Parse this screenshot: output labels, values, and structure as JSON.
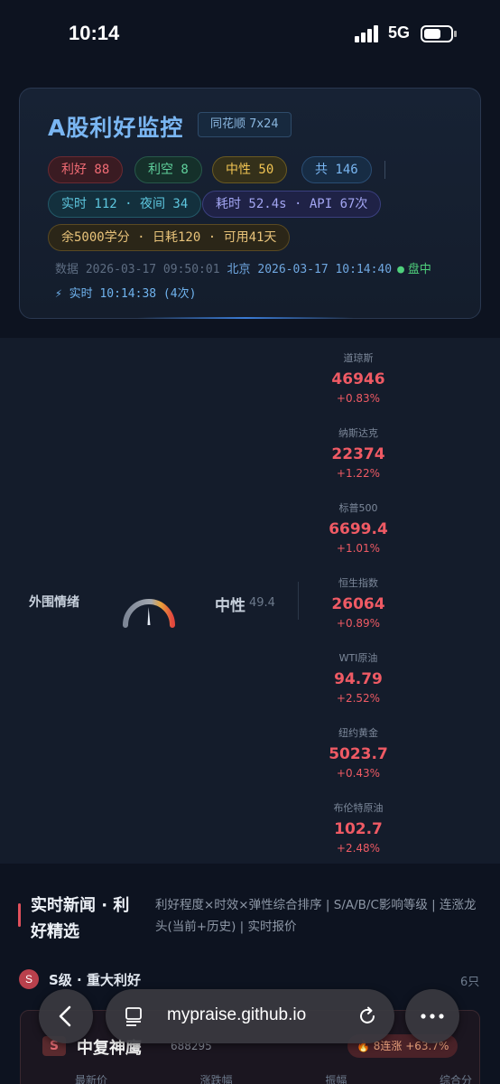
{
  "status_bar": {
    "time": "10:14",
    "network": "5G"
  },
  "header": {
    "title": "A股利好监控",
    "source_badge": "同花顺 7x24",
    "counts": {
      "positive": "利好 88",
      "negative": "利空 8",
      "neutral": "中性 50",
      "total": "共 146"
    },
    "realtime_pill": "实时 112 · 夜间 34",
    "timing_pill": "耗时 52.4s · API 67次",
    "quota_pill": "余5000学分 · 日耗120 · 可用41天",
    "data_time": "数据 2026-03-17 09:50:01",
    "beijing_time": "北京 2026-03-17 10:14:40",
    "market_status_dot": "●",
    "market_status": "盘中",
    "realtime_update": "⚡ 实时 10:14:38 (4次)"
  },
  "sentiment": {
    "label": "外围情绪",
    "value": "中性",
    "score": "49.4",
    "gauge_level": 0.494
  },
  "indices": [
    {
      "name": "道琼斯",
      "value": "46946",
      "change": "+0.83%"
    },
    {
      "name": "纳斯达克",
      "value": "22374",
      "change": "+1.22%"
    },
    {
      "name": "标普500",
      "value": "6699.4",
      "change": "+1.01%"
    },
    {
      "name": "恒生指数",
      "value": "26064",
      "change": "+0.89%"
    },
    {
      "name": "WTI原油",
      "value": "94.79",
      "change": "+2.52%"
    },
    {
      "name": "纽约黄金",
      "value": "5023.7",
      "change": "+0.43%"
    },
    {
      "name": "布伦特原油",
      "value": "102.7",
      "change": "+2.48%"
    }
  ],
  "news": {
    "title": "实时新闻 · 利好精选",
    "description": "利好程度×时效×弹性综合排序 | S/A/B/C影响等级 | 连涨龙头(当前+历史) | 实时报价",
    "tier": {
      "badge": "S",
      "label": "S级 · 重大利好",
      "count": "6只"
    },
    "stock": {
      "icon": "S",
      "name": "中复神鹰",
      "code": "688295",
      "streak": "🔥 8连涨 +63.7%",
      "columns": [
        "最新价",
        "涨跌幅",
        "振幅",
        "综合分"
      ]
    }
  },
  "browser": {
    "url": "mypraise.github.io"
  },
  "colors": {
    "positive": "#ef5a64",
    "accent": "#7ab6f2",
    "gauge_left": "#8a93a3",
    "gauge_right": "#e35a4a"
  }
}
